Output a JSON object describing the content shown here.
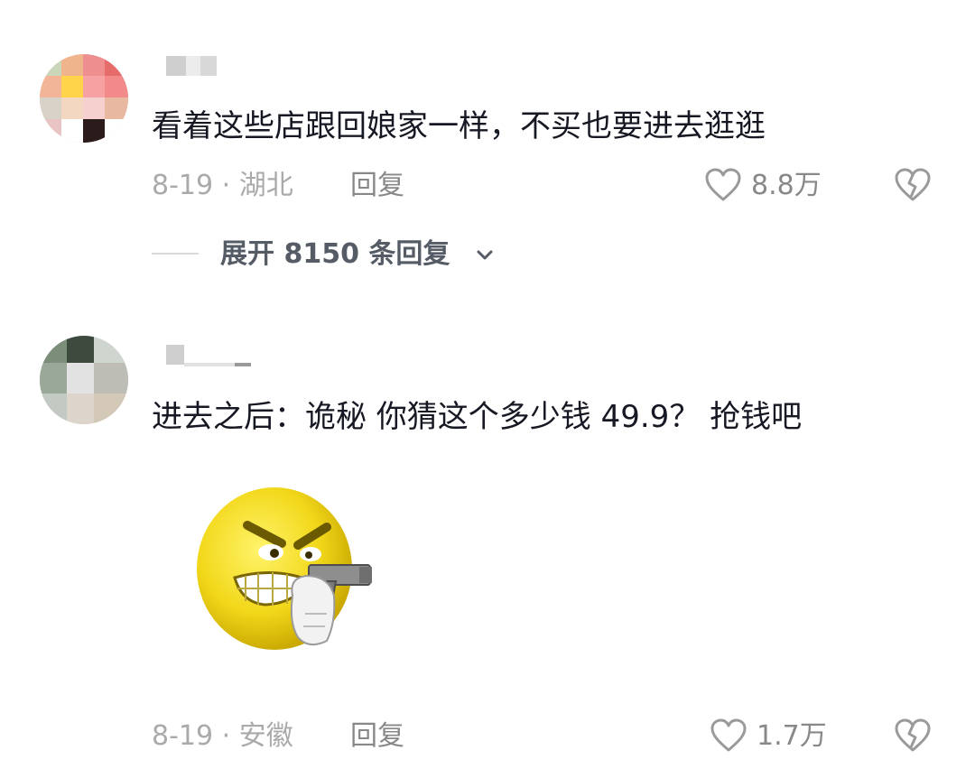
{
  "comments": [
    {
      "text": "看着这些店跟回娘家一样，不买也要进去逛逛",
      "meta": "8-19 · 湖北",
      "reply_label": "回复",
      "likes": "8.8万",
      "expand_label": "展开 8150 条回复"
    },
    {
      "text": "进去之后：诡秘 你猜这个多少钱 49.9？ 抢钱吧",
      "meta": "8-19 · 安徽",
      "reply_label": "回复",
      "likes": "1.7万"
    }
  ],
  "icons": {
    "like": "heart-outline-icon",
    "dislike": "broken-heart-icon",
    "expand": "chevron-down-icon",
    "sticker": "angry-emoji-with-gun-sticker"
  },
  "colors": {
    "text": "#161823",
    "meta": "#aaaaaa",
    "reply": "#888888",
    "expand": "#555c66"
  }
}
